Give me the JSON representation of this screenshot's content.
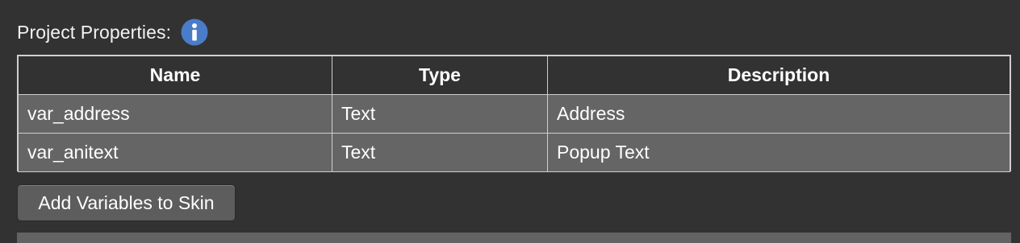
{
  "header": {
    "label": "Project Properties:",
    "info_icon": "info-icon",
    "info_color": "#4a7cc9"
  },
  "table": {
    "columns": [
      "Name",
      "Type",
      "Description"
    ],
    "rows": [
      {
        "name": "var_address",
        "type": "Text",
        "description": "Address"
      },
      {
        "name": "var_anitext",
        "type": "Text",
        "description": "Popup Text"
      }
    ]
  },
  "actions": {
    "add_variables_label": "Add Variables to Skin"
  }
}
